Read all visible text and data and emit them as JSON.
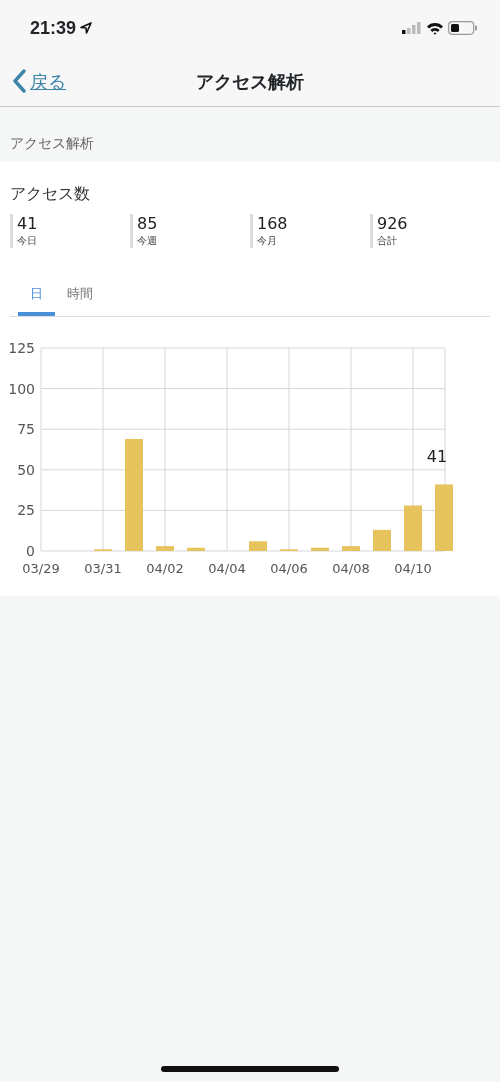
{
  "status_bar": {
    "time": "21:39"
  },
  "nav": {
    "back": "戻る",
    "title": "アクセス解析"
  },
  "section_header": "アクセス解析",
  "card": {
    "title": "アクセス数",
    "stats": [
      {
        "value": "41",
        "label": "今日"
      },
      {
        "value": "85",
        "label": "今週"
      },
      {
        "value": "168",
        "label": "今月"
      },
      {
        "value": "926",
        "label": "合計"
      }
    ],
    "tabs": [
      {
        "label": "日",
        "selected": true
      },
      {
        "label": "時間",
        "selected": false
      }
    ],
    "chart_data": {
      "type": "bar",
      "categories": [
        "03/29",
        null,
        "03/31",
        null,
        "04/02",
        null,
        "04/04",
        null,
        "04/06",
        null,
        "04/08",
        null,
        "04/10",
        null
      ],
      "series": [
        {
          "color": "#e6c35c",
          "values": [
            0,
            0,
            1,
            69,
            3,
            2,
            0,
            6,
            1,
            2,
            3,
            13,
            28,
            41
          ]
        }
      ],
      "ylim": [
        0,
        125
      ],
      "yticks": [
        0,
        25,
        50,
        75,
        100,
        125
      ],
      "grid": true,
      "annotations": [
        "41"
      ]
    }
  }
}
